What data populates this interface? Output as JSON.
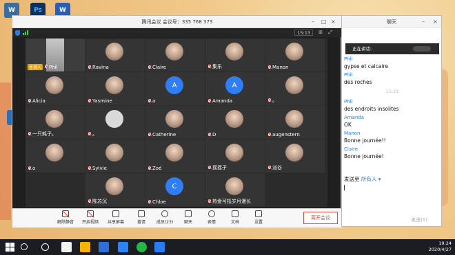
{
  "meeting": {
    "title": "腾讯会议 会议号：335 768 373",
    "time": "15:13",
    "host_badge": "主持人",
    "participants": [
      {
        "name": "Phil",
        "avatar": "photo-me"
      },
      {
        "name": "Ravina",
        "avatar": "photo"
      },
      {
        "name": "Claire",
        "avatar": "photo"
      },
      {
        "name": "集乐",
        "avatar": "photo"
      },
      {
        "name": "Manon",
        "avatar": "photo"
      },
      {
        "name": "Alicia",
        "avatar": "photo"
      },
      {
        "name": "Yasmine",
        "avatar": "photo"
      },
      {
        "name": "a",
        "avatar": "letter",
        "letter": "A"
      },
      {
        "name": "Amanda",
        "avatar": "letter",
        "letter": "A"
      },
      {
        "name": "。",
        "avatar": "photo"
      },
      {
        "name": "一只耗子。",
        "avatar": "photo"
      },
      {
        "name": "。",
        "avatar": "blank"
      },
      {
        "name": "Catherine",
        "avatar": "photo"
      },
      {
        "name": "D",
        "avatar": "photo"
      },
      {
        "name": "augenstern",
        "avatar": "photo"
      },
      {
        "name": "o",
        "avatar": "photo"
      },
      {
        "name": "Sylvie",
        "avatar": "photo"
      },
      {
        "name": "Zoé",
        "avatar": "photo"
      },
      {
        "name": "摇摇子",
        "avatar": "photo"
      },
      {
        "name": "派谷",
        "avatar": "photo"
      },
      {
        "name": "陈苏沉",
        "avatar": "photo"
      },
      {
        "name": "Chloe",
        "avatar": "letter",
        "letter": "C"
      },
      {
        "name": "热爱可抵岁月漫长",
        "avatar": "photo"
      }
    ],
    "toolbar": [
      {
        "label": "解除静音",
        "icon": "mic-off-icon"
      },
      {
        "label": "开启视频",
        "icon": "video-off-icon"
      },
      {
        "label": "共享屏幕",
        "icon": "share-screen-icon"
      },
      {
        "label": "邀请",
        "icon": "invite-icon"
      },
      {
        "label": "成员(23)",
        "icon": "members-icon"
      },
      {
        "label": "聊天",
        "icon": "chat-icon"
      },
      {
        "label": "表情",
        "icon": "emoji-icon"
      },
      {
        "label": "文档",
        "icon": "document-icon"
      },
      {
        "label": "设置",
        "icon": "settings-icon"
      }
    ],
    "leave_label": "离开会议"
  },
  "chat": {
    "title": "聊天",
    "speaking_label": "正在讲话:",
    "messages": [
      {
        "name": "Phil",
        "text": "gypse et calcaire"
      },
      {
        "name": "Phil",
        "text": "des roches"
      },
      {
        "time": "15:21"
      },
      {
        "name": "Phil",
        "text": "des endroits insolites"
      },
      {
        "name": "Amanda",
        "text": "OK"
      },
      {
        "name": "Manon",
        "text": "Bonne journée!!"
      },
      {
        "name": "Claire",
        "text": "Bonne journée!"
      }
    ],
    "send_to_label": "发送至",
    "send_to_target": "所有人",
    "send_label": "发送(S)"
  },
  "desktop": {
    "icons": [
      "W",
      "Ps",
      "W"
    ]
  },
  "taskbar": {
    "clock_time": "19:24",
    "clock_date": "2020/4/27"
  }
}
